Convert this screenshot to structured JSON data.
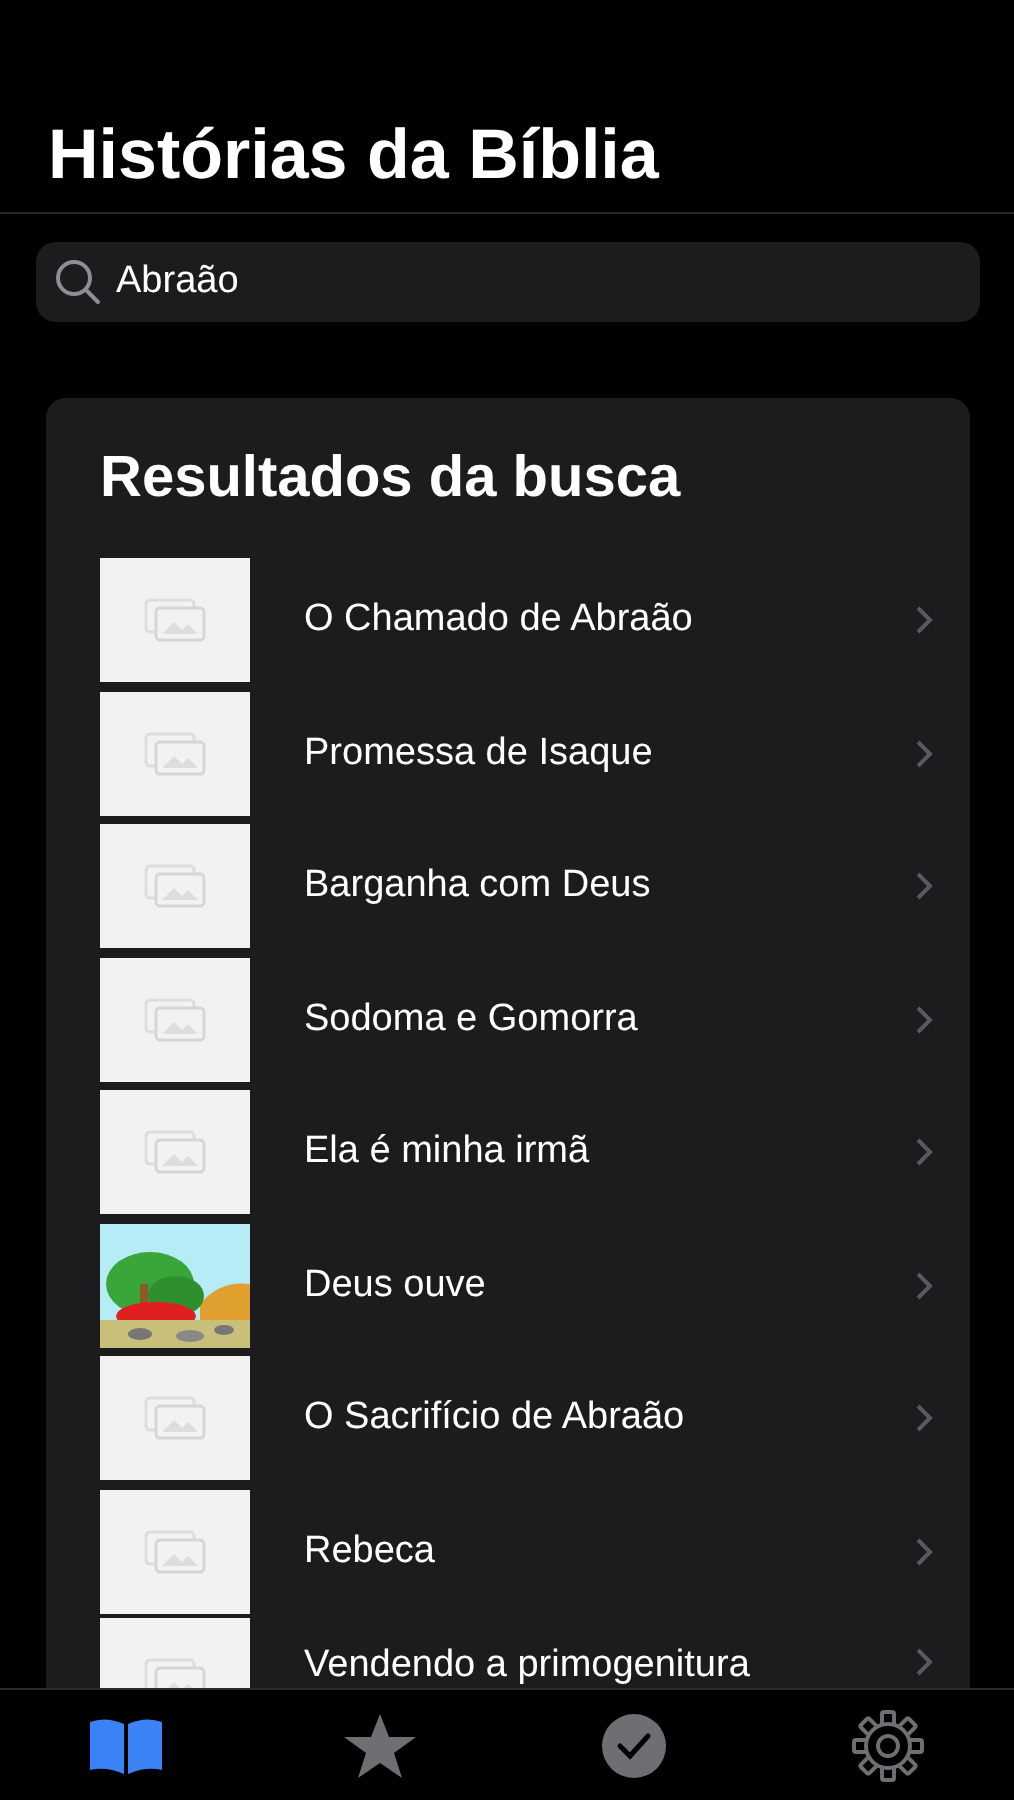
{
  "title": "Histórias da Bíblia",
  "search": {
    "value": "Abraão"
  },
  "results": {
    "heading": "Resultados da busca",
    "items": [
      {
        "title": "O Chamado de Abraão",
        "kind": "placeholder"
      },
      {
        "title": "Promessa de Isaque",
        "kind": "placeholder"
      },
      {
        "title": "Barganha com Deus",
        "kind": "placeholder"
      },
      {
        "title": "Sodoma e Gomorra",
        "kind": "placeholder"
      },
      {
        "title": "Ela é minha irmã",
        "kind": "placeholder"
      },
      {
        "title": "Deus ouve",
        "kind": "picture"
      },
      {
        "title": "O Sacrifício de Abraão",
        "kind": "placeholder"
      },
      {
        "title": "Rebeca",
        "kind": "placeholder"
      },
      {
        "title": "Vendendo a primogenitura",
        "kind": "placeholder"
      }
    ]
  },
  "tab_bar": [
    {
      "kind": "book",
      "selected": true
    },
    {
      "kind": "star",
      "selected": false
    },
    {
      "kind": "check",
      "selected": false
    },
    {
      "kind": "gear",
      "selected": false
    }
  ]
}
